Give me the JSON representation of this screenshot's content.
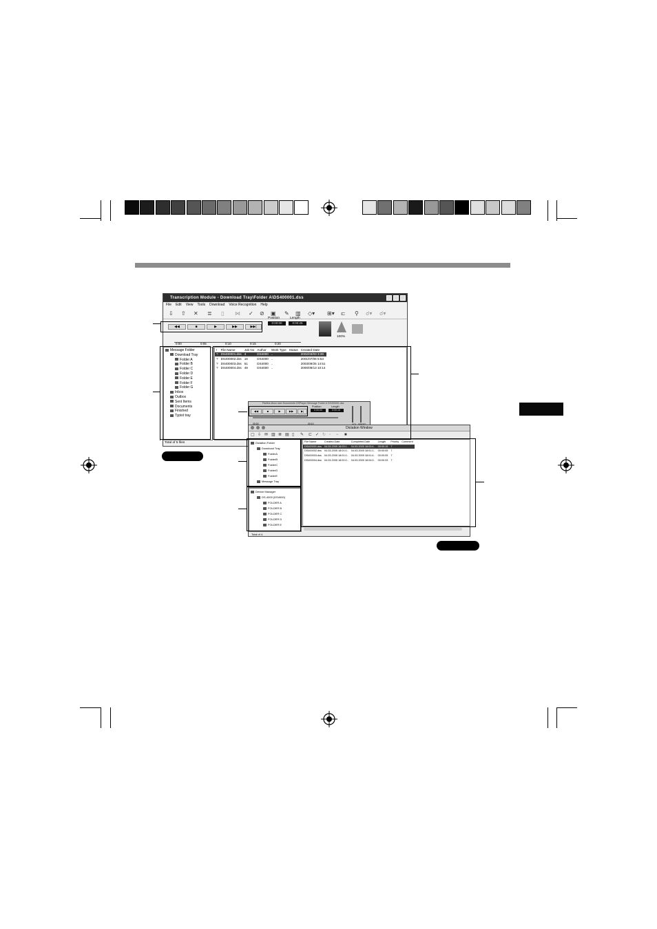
{
  "colors": {
    "left_swatches": [
      "#0a0a0a",
      "#1c1c1c",
      "#2e2e2e",
      "#404040",
      "#555555",
      "#6a6a6a",
      "#808080",
      "#999999",
      "#b3b3b3",
      "#cccccc",
      "#e6e6e6",
      "#ffffff"
    ],
    "right_swatches": [
      "#e6e6e6",
      "#707070",
      "#b3b3b3",
      "#1a1a1a",
      "#999999",
      "#555555",
      "#000000",
      "#e0e0e0",
      "#c8c8c8",
      "#dddddd",
      "#808080"
    ],
    "section_bar": "#8c8c8c",
    "side_tab": "#0a0a0a"
  },
  "transcription_window": {
    "title": "Transcription Module - Download Tray\\Folder A\\DS400001.dss",
    "menu": [
      "File",
      "Edit",
      "View",
      "Tools",
      "Download",
      "Voice Recognition",
      "Help"
    ],
    "position_label": "Position",
    "position_value": "0:00:00",
    "length_label": "Length",
    "length_value": "0:00:25",
    "speed_value": "100%",
    "timeline_ticks": [
      "0:00",
      "0:05",
      "0:10",
      "0:15",
      "0:20"
    ],
    "tree": [
      {
        "label": "Message Folder",
        "level": 0
      },
      {
        "label": "Download Tray",
        "level": 1
      },
      {
        "label": "Folder A",
        "level": 2
      },
      {
        "label": "Folder B",
        "level": 2
      },
      {
        "label": "Folder C",
        "level": 2
      },
      {
        "label": "Folder D",
        "level": 2
      },
      {
        "label": "Folder E",
        "level": 2
      },
      {
        "label": "Folder F",
        "level": 2
      },
      {
        "label": "Folder G",
        "level": 2
      },
      {
        "label": "Inbox",
        "level": 1
      },
      {
        "label": "Outbox",
        "level": 1
      },
      {
        "label": "Sent Items",
        "level": 1
      },
      {
        "label": "Documents",
        "level": 1
      },
      {
        "label": "Finished",
        "level": 1
      },
      {
        "label": "Typist tray",
        "level": 1
      }
    ],
    "columns": [
      "!",
      "File Name",
      "Job No",
      "Author",
      "Work Type",
      "Status",
      "Created Date"
    ],
    "rows": [
      [
        "?",
        "DS400001.dss",
        "4",
        "DS4000",
        "..",
        "",
        "2002/03/03 3:39"
      ],
      [
        "?",
        "DS400002.dss",
        "16",
        "DS4000",
        "..",
        "",
        "2001/07/06 5:53"
      ],
      [
        "?",
        "DS400003.dss",
        "51",
        "DS4000",
        "..",
        "",
        "2003/09/25 14:51"
      ],
      [
        "?",
        "DS400004.dss",
        "49",
        "DS4000",
        "..",
        "",
        "2000/09/13 10:14"
      ]
    ],
    "status": "Total of 5 files"
  },
  "dictation_window": {
    "player_title": "Pantha disco user Documents DSPlayer Message Folder A DS400001.dss",
    "position_label": "Position",
    "position_value": "0:00:00",
    "length_label": "Length",
    "length_value": "0:00:15",
    "vol_label": "VOL",
    "speed_label": "SPEED",
    "ticks": [
      "00:00",
      "00:10"
    ],
    "title": "Dictation Window",
    "tree_top": [
      {
        "label": "Dictation Folder",
        "level": 0
      },
      {
        "label": "Download Tray",
        "level": 1
      },
      {
        "label": "FolderA",
        "level": 2
      },
      {
        "label": "FolderB",
        "level": 2
      },
      {
        "label": "FolderC",
        "level": 2
      },
      {
        "label": "FolderD",
        "level": 2
      },
      {
        "label": "FolderE",
        "level": 2
      },
      {
        "label": "Message Tray",
        "level": 1
      }
    ],
    "tree_bottom": [
      {
        "label": "Device Manager",
        "level": 0
      },
      {
        "label": "DS-4000 (DS4000)",
        "level": 1
      },
      {
        "label": "FOLDER A",
        "level": 2
      },
      {
        "label": "FOLDER B",
        "level": 2
      },
      {
        "label": "FOLDER C",
        "level": 2
      },
      {
        "label": "FOLDER D",
        "level": 2
      },
      {
        "label": "FOLDER E",
        "level": 2
      }
    ],
    "columns": [
      "File Name",
      "Created Date",
      "Completed Date",
      "Length",
      "Priority",
      "Comment"
    ],
    "rows": [
      [
        "DS400001.dss",
        "04.03.2005 18:03:1..",
        "04.03.2005 18:03:4..",
        "00:00:15",
        "7",
        ""
      ],
      [
        "DS400002.dss",
        "04.03.2005 18:01:0..",
        "04.03.2005 18:01:1..",
        "00:00:05",
        "7",
        ""
      ],
      [
        "DS400003.dss",
        "04.03.2005 18:01:0..",
        "04.03.2005 18:01:4..",
        "00:00:05",
        "7",
        ""
      ],
      [
        "DS400004.dss",
        "04.03.2005 18:02:0..",
        "04.03.2005 18:04:0..",
        "00:00:33",
        "7",
        ""
      ]
    ],
    "status": "Total of 4."
  }
}
